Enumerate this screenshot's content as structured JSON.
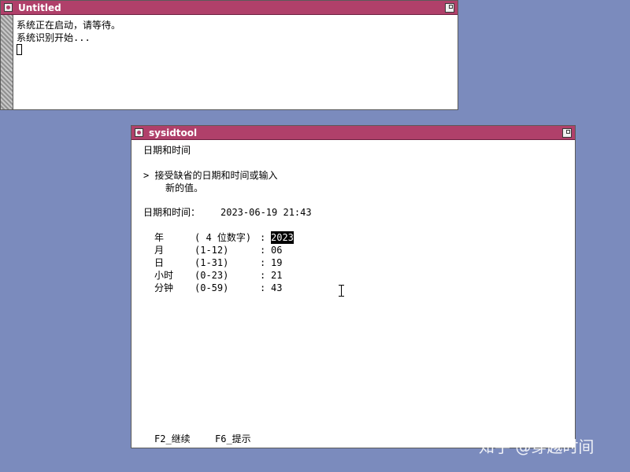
{
  "untitled_window": {
    "title": "Untitled",
    "console_lines": [
      "系统正在启动，请等待。",
      "系统识别开始..."
    ]
  },
  "sysid_window": {
    "title": "sysidtool",
    "heading": "日期和时间",
    "instruction_line1": "> 接受缺省的日期和时间或输入",
    "instruction_line2": "新的值。",
    "datetime_label": "日期和时间：",
    "datetime_value": "2023-06-19 21:43",
    "fields": [
      {
        "label": "年",
        "range": "( 4 位数字)",
        "value": "2023",
        "selected": true
      },
      {
        "label": "月",
        "range": "(1-12)",
        "value": "06"
      },
      {
        "label": "日",
        "range": "(1-31)",
        "value": "19"
      },
      {
        "label": "小时",
        "range": "(0-23)",
        "value": "21"
      },
      {
        "label": "分钟",
        "range": "(0-59)",
        "value": "43"
      }
    ],
    "footer": {
      "f2": "F2_继续",
      "f6": "F6_提示"
    }
  },
  "watermark": "知乎 @穿越时间",
  "colors": {
    "desktop": "#7b8bbd",
    "titlebar": "#b0406a"
  }
}
